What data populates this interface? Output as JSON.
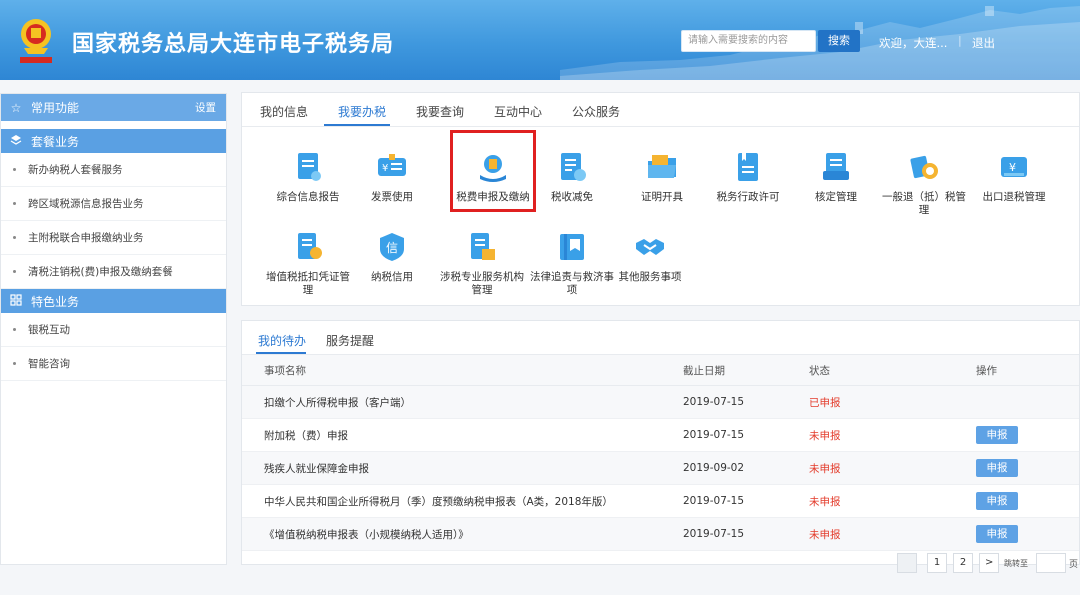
{
  "header": {
    "title": "国家税务总局大连市电子税务局",
    "search_placeholder": "请输入需要搜索的内容",
    "search_button": "搜索",
    "welcome": "欢迎，大连...",
    "separator": "|",
    "logout": "退出",
    "colors": {
      "header_bg": "#3f98de",
      "search_btn": "#2273c6"
    }
  },
  "sidebar": {
    "common_label": "常用功能",
    "settings_label": "设置",
    "package_label": "套餐业务",
    "package_items": [
      "新办纳税人套餐服务",
      "跨区域税源信息报告业务",
      "主附税联合申报缴纳业务",
      "清税注销税(费)申报及缴纳套餐"
    ],
    "featured_label": "特色业务",
    "featured_items": [
      "银税互动",
      "智能咨询"
    ]
  },
  "top_tabs": [
    "我的信息",
    "我要办税",
    "我要查询",
    "互动中心",
    "公众服务"
  ],
  "active_top_tab": "我要办税",
  "services": [
    {
      "label": "综合信息报告",
      "icon": "document-report-icon"
    },
    {
      "label": "发票使用",
      "icon": "invoice-icon"
    },
    {
      "label": "税费申报及缴纳",
      "icon": "tax-declare-icon"
    },
    {
      "label": "税收减免",
      "icon": "tax-reduction-icon"
    },
    {
      "label": "证明开具",
      "icon": "folder-certificate-icon"
    },
    {
      "label": "税务行政许可",
      "icon": "bookmark-doc-icon"
    },
    {
      "label": "核定管理",
      "icon": "assessment-icon"
    },
    {
      "label": "一般退（抵）税管理",
      "icon": "refund-coin-icon"
    },
    {
      "label": "出口退税管理",
      "icon": "export-refund-icon"
    },
    {
      "label": "增值税抵扣凭证管理",
      "icon": "vat-deduction-icon"
    },
    {
      "label": "纳税信用",
      "icon": "credit-icon"
    },
    {
      "label": "涉税专业服务机构管理",
      "icon": "agency-icon"
    },
    {
      "label": "法律追责与救济事项",
      "icon": "law-book-icon"
    },
    {
      "label": "其他服务事项",
      "icon": "handshake-icon"
    }
  ],
  "pending": {
    "tabs": [
      "我的待办",
      "服务提醒"
    ],
    "active_tab": "我的待办",
    "columns": [
      "事项名称",
      "截止日期",
      "状态",
      "操作"
    ],
    "rows": [
      {
        "name": "扣缴个人所得税申报（客户端）",
        "deadline": "2019-07-15",
        "status": "已申报",
        "action": ""
      },
      {
        "name": "附加税（费）申报",
        "deadline": "2019-07-15",
        "status": "未申报",
        "action": "申报"
      },
      {
        "name": "残疾人就业保障金申报",
        "deadline": "2019-09-02",
        "status": "未申报",
        "action": "申报"
      },
      {
        "name": "中华人民共和国企业所得税月（季）度预缴纳税申报表（A类，2018年版）",
        "deadline": "2019-07-15",
        "status": "未申报",
        "action": "申报"
      },
      {
        "name": "《增值税纳税申报表（小规模纳税人适用）》",
        "deadline": "2019-07-15",
        "status": "未申报",
        "action": "申报"
      }
    ]
  },
  "pagination": {
    "pages": [
      "1",
      "2"
    ],
    "next": ">",
    "jump_label": "跳转至",
    "page_suffix": "页"
  }
}
